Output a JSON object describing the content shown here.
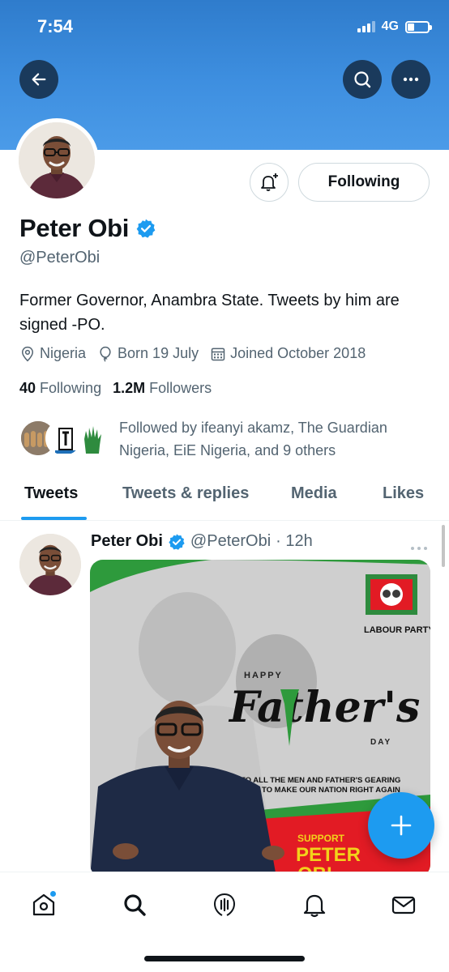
{
  "status_bar": {
    "time": "7:54",
    "network": "4G"
  },
  "profile": {
    "name": "Peter Obi",
    "handle": "@PeterObi",
    "bio": "Former Governor, Anambra State. Tweets by him are signed -PO.",
    "location": "Nigeria",
    "birthday": "Born 19 July",
    "joined": "Joined October 2018",
    "following_count": "40",
    "following_label": "Following",
    "followers_count": "1.2M",
    "followers_label": "Followers",
    "followed_by": "Followed by ifeanyi akamz, The Guardian Nigeria, EiE Nigeria, and 9 others",
    "following_button": "Following"
  },
  "tabs": [
    {
      "label": "Tweets",
      "active": true
    },
    {
      "label": "Tweets & replies",
      "active": false
    },
    {
      "label": "Media",
      "active": false
    },
    {
      "label": "Likes",
      "active": false
    }
  ],
  "tweet": {
    "name": "Peter Obi",
    "handle": "@PeterObi",
    "time": "· 12h",
    "image_text": {
      "party": "LABOUR PARTY",
      "happy": "HAPPY",
      "fathers": "Father's",
      "day": "DAY",
      "message_line1": "TO ALL THE MEN AND FATHER'S GEARING",
      "message_line2": "TO MAKE OUR NATION RIGHT AGAIN",
      "support": "SUPPORT",
      "candidate": "PETER",
      "candidate_2": "OBI"
    }
  },
  "colors": {
    "accent": "#1d9bf0",
    "banner": "#3e8fe0",
    "text": "#0f1419",
    "secondary": "#536471"
  },
  "icons": [
    "back-arrow-icon",
    "search-icon",
    "more-icon",
    "bell-plus-icon",
    "verified-badge-icon",
    "location-icon",
    "balloon-icon",
    "calendar-icon",
    "home-icon",
    "explore-icon",
    "spaces-icon",
    "notifications-icon",
    "messages-icon",
    "compose-icon"
  ]
}
